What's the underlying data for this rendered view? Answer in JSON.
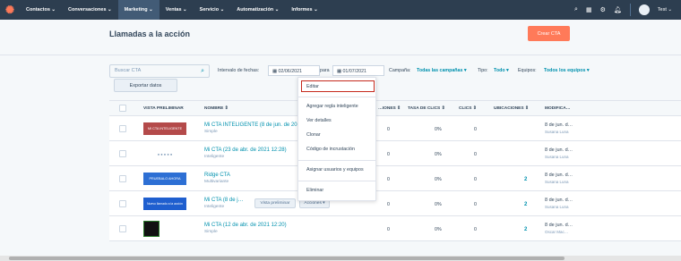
{
  "nav": {
    "items": [
      "Contactos ⌄",
      "Conversaciones ⌄",
      "Marketing ⌄",
      "Ventas ⌄",
      "Servicio ⌄",
      "Automatización ⌄",
      "Informes ⌄"
    ],
    "user": "Test ⌄"
  },
  "header": {
    "title": "Llamadas a la acción",
    "create_label": "Crear CTA"
  },
  "filters": {
    "search_placeholder": "Buscar CTA",
    "date_label": "Intervalo de fechas:",
    "date_from": "02/06/2021",
    "para": "para",
    "date_to": "01/07/2021",
    "campaign_label": "Campaña:",
    "campaign_value": "Todas las campañas ▾",
    "type_label": "Tipo:",
    "type_value": "Todo ▾",
    "team_label": "Equipos:",
    "team_value": "Todos los equipos ▾",
    "export_label": "Exportar datos"
  },
  "table": {
    "headers": [
      "VISTA PRELIMINAR",
      "NOMBRE ⇕",
      "…IONES ⇕",
      "TASA DE CLICS ⇕",
      "CLICS ⇕",
      "UBICACIONES ⇕",
      "MODIFICA…"
    ],
    "rows": [
      {
        "thumb": "MI CTA INTELIGENTE",
        "name": "Mi CTA INTELIGENTE (8 de jun. de 2021 …",
        "sub": "Simple",
        "views": "0",
        "rate": "0%",
        "clicks": "0",
        "locations": "",
        "mod": "8 de jun. d…",
        "modsub": "Susana Luna"
      },
      {
        "thumb": "● ● ● ● ●",
        "name": "Mi CTA (23 de abr. de 2021 12:28)",
        "sub": "Inteligente",
        "views": "0",
        "rate": "0%",
        "clicks": "0",
        "locations": "",
        "mod": "8 de jun. d…",
        "modsub": "Susana Luna"
      },
      {
        "thumb": "PRUEBALO AHORA",
        "name": "Ridge CTA",
        "sub": "Multivariante",
        "views": "0",
        "rate": "0%",
        "clicks": "0",
        "locations": "2",
        "mod": "8 de jun. d…",
        "modsub": "Susana Luna"
      },
      {
        "thumb": "Nuevo llamado a la acción",
        "name": "Mi CTA (8 de j…",
        "sub": "Inteligente",
        "views": "0",
        "rate": "0%",
        "clicks": "0",
        "locations": "2",
        "mod": "8 de jun. d…",
        "modsub": "Susana Luna",
        "preview_btn": "Vista preliminar",
        "actions_btn": "Acciones ▾"
      },
      {
        "thumb": "",
        "name": "Mi CTA (12 de abr. de 2021 12:20)",
        "sub": "Simple",
        "views": "0",
        "rate": "0%",
        "clicks": "0",
        "locations": "2",
        "mod": "8 de jun. d…",
        "modsub": "Oscar Mac…"
      }
    ]
  },
  "dropdown": {
    "items": [
      "Editar",
      "Agregar regla inteligente",
      "Ver detalles",
      "Clonar",
      "Código de incrustación",
      "Asignar usuarios y equipos",
      "Eliminar"
    ]
  },
  "colors": {
    "nav": "#2d3e50",
    "accent": "#ff7a59",
    "link": "#0091ae",
    "highlight": "#c5281c"
  }
}
